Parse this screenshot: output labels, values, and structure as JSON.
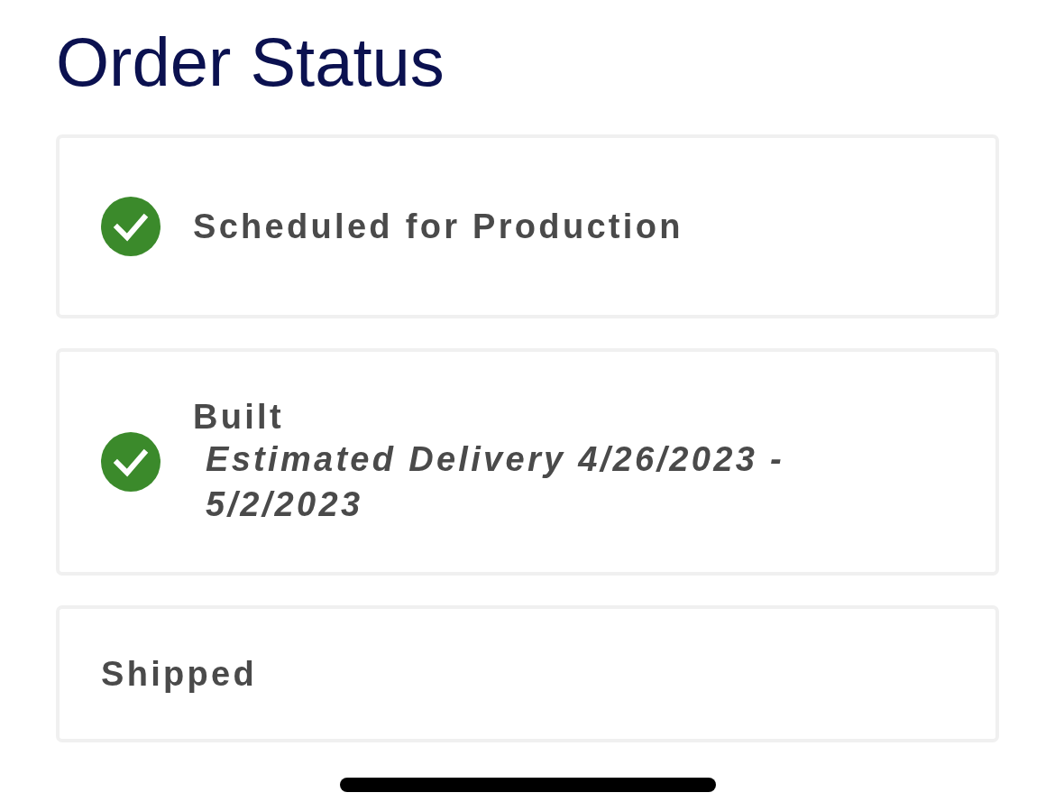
{
  "page": {
    "title": "Order Status"
  },
  "steps": [
    {
      "label": "Scheduled for Production",
      "completed": true
    },
    {
      "label": "Built",
      "completed": true,
      "detail": "Estimated Delivery 4/26/2023 - 5/2/2023"
    },
    {
      "label": "Shipped",
      "completed": false
    }
  ]
}
